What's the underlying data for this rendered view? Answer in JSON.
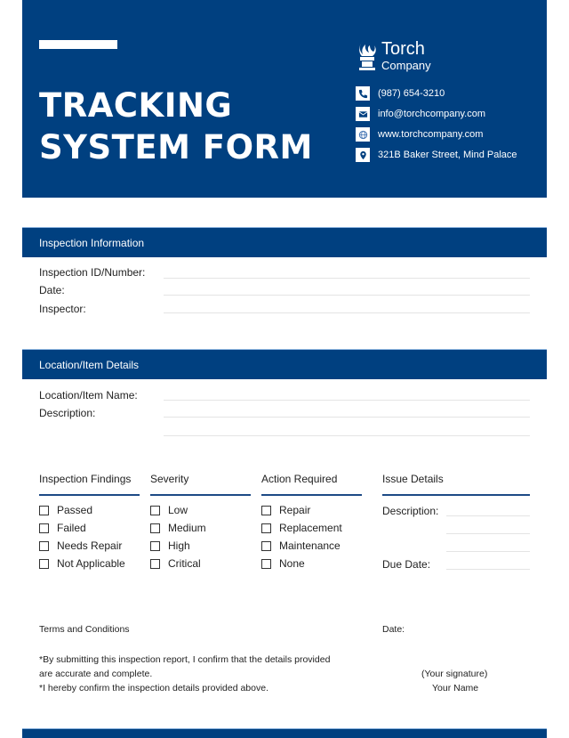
{
  "header": {
    "title_line1": "TRACKING",
    "title_line2": "SYSTEM FORM",
    "logo": {
      "icon": "torch-icon",
      "name": "Torch",
      "subtitle": "Company"
    },
    "contacts": [
      {
        "icon": "phone-icon",
        "text": "(987) 654-3210"
      },
      {
        "icon": "mail-icon",
        "text": "info@torchcompany.com"
      },
      {
        "icon": "globe-icon",
        "text": "www.torchcompany.com"
      },
      {
        "icon": "location-pin-icon",
        "text": "321B Baker Street, Mind Palace"
      }
    ]
  },
  "inspection_info": {
    "heading": "Inspection Information",
    "fields": [
      {
        "label": "Inspection ID/Number:",
        "value": ""
      },
      {
        "label": "Date:",
        "value": ""
      },
      {
        "label": "Inspector:",
        "value": ""
      }
    ]
  },
  "location_details": {
    "heading": "Location/Item Details",
    "fields": [
      {
        "label": "Location/Item Name:",
        "value": ""
      },
      {
        "label": "Description:",
        "value": ""
      }
    ]
  },
  "columns": {
    "findings": {
      "heading": "Inspection Findings",
      "options": [
        "Passed",
        "Failed",
        "Needs Repair",
        "Not Applicable"
      ]
    },
    "severity": {
      "heading": "Severity",
      "options": [
        "Low",
        "Medium",
        "High",
        "Critical"
      ]
    },
    "action": {
      "heading": "Action Required",
      "options": [
        "Repair",
        "Replacement",
        "Maintenance",
        "None"
      ]
    },
    "issue": {
      "heading": "Issue Details",
      "description_label": "Description:",
      "due_date_label": "Due Date:"
    }
  },
  "terms": {
    "heading": "Terms and Conditions",
    "line1": "*By submitting this inspection report, I confirm that the details provided",
    "line2": "are accurate and complete.",
    "line3": "*I hereby confirm the inspection details provided above.",
    "date_label": "Date:",
    "signature_label": "(Your signature)",
    "name_label": "Your Name"
  },
  "colors": {
    "brand_blue": "#004080",
    "white": "#ffffff"
  }
}
